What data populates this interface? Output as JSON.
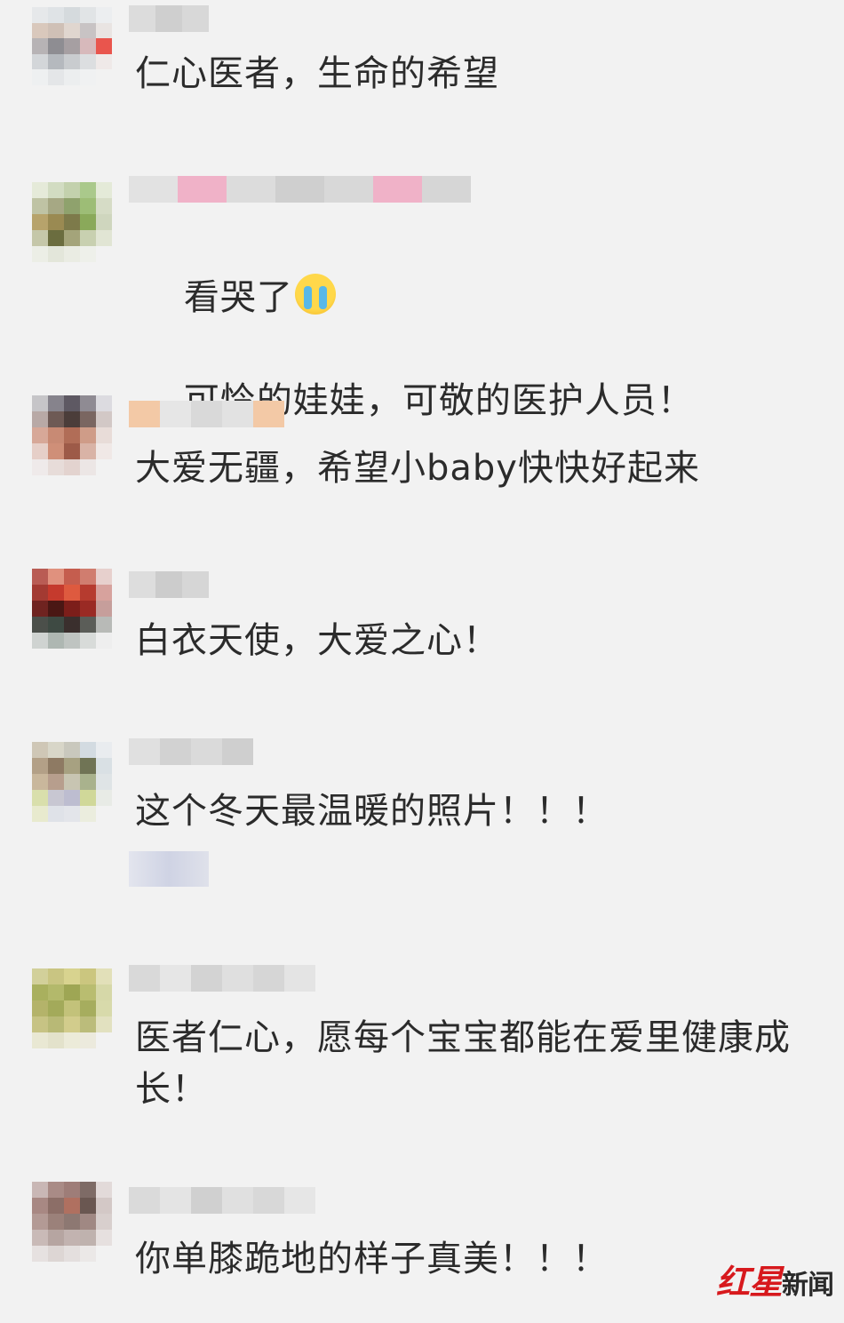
{
  "comments": [
    {
      "text": "仁心医者，生命的希望"
    },
    {
      "text_line1": "看哭了",
      "emoji": "crying-face-icon",
      "text_line2": "可怜的娃娃，可敬的医护人员！"
    },
    {
      "text": "大爱无疆，希望小baby快快好起来"
    },
    {
      "text": "白衣天使，大爱之心！"
    },
    {
      "text": "这个冬天最温暖的照片！！！"
    },
    {
      "text": "医者仁心，愿每个宝宝都能在爱里健康成长！"
    },
    {
      "text": "你单膝跪地的样子真美！！！"
    }
  ],
  "watermark": {
    "part1": "红星",
    "part2": "新闻"
  },
  "colors": {
    "background": "#f2f2f2",
    "text": "#2b2b2b",
    "brand_red": "#d7191d"
  }
}
